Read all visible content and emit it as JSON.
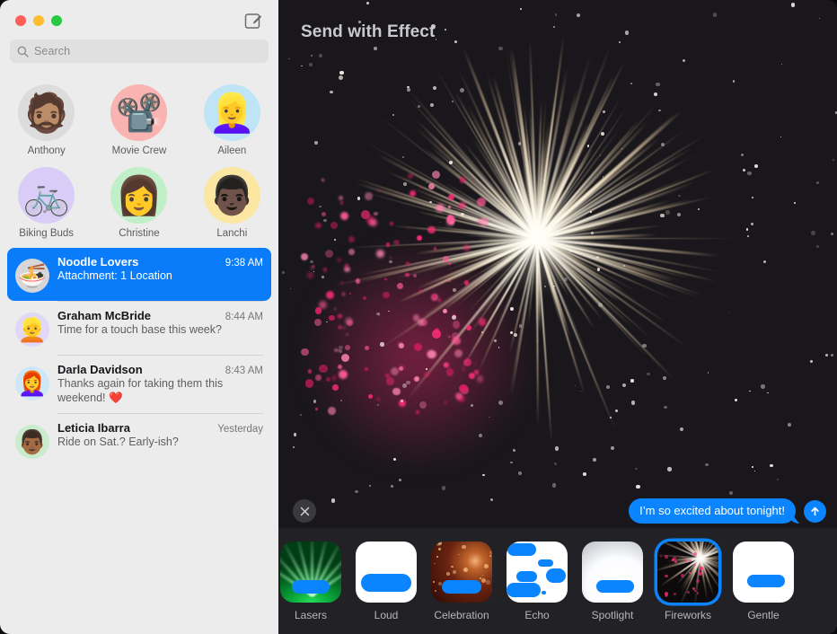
{
  "window": {
    "traffic_lights": [
      "close",
      "minimize",
      "maximize"
    ],
    "colors": {
      "close": "#ff5f57",
      "minimize": "#febc2e",
      "maximize": "#28c840",
      "accent_blue": "#0a7cfa",
      "bubble_blue": "#0a84ff",
      "sidebar_bg": "#ececec",
      "stage_bg": "#19171b",
      "strip_bg": "#222226"
    }
  },
  "sidebar": {
    "compose_icon": "compose-pencil-icon",
    "search": {
      "icon": "search-icon",
      "placeholder": "Search",
      "value": ""
    },
    "pinned": [
      {
        "label": "Anthony",
        "glyph": "🧔🏽",
        "bg": "#dcdcdc"
      },
      {
        "label": "Movie Crew",
        "glyph": "📽️",
        "bg": "#f9b3b0"
      },
      {
        "label": "Aileen",
        "glyph": "👱‍♀️",
        "bg": "#bfe4f5"
      },
      {
        "label": "Biking Buds",
        "glyph": "🚲",
        "bg": "#d9cdf7"
      },
      {
        "label": "Christine",
        "glyph": "👩",
        "bg": "#c1efc7"
      },
      {
        "label": "Lanchi",
        "glyph": "👨🏿",
        "bg": "#fbe6a2"
      }
    ],
    "conversations": [
      {
        "name": "Noodle Lovers",
        "time": "9:38 AM",
        "preview": "Attachment: 1 Location",
        "glyph": "🍜",
        "bg": "#d6d6d8",
        "selected": true
      },
      {
        "name": "Graham McBride",
        "time": "8:44 AM",
        "preview": "Time for a touch base this week?",
        "glyph": "👱",
        "bg": "#e1d7f8",
        "selected": false
      },
      {
        "name": "Darla Davidson",
        "time": "8:43 AM",
        "preview": "Thanks again for taking them this weekend! ❤️",
        "glyph": "👩‍🦰",
        "bg": "#cfe8f7",
        "selected": false
      },
      {
        "name": "Leticia Ibarra",
        "time": "Yesterday",
        "preview": "Ride on Sat.? Early-ish?",
        "glyph": "👨🏾",
        "bg": "#c9edcc",
        "selected": false
      }
    ]
  },
  "main": {
    "title": "Send with Effect",
    "close_effect_icon": "close-icon",
    "message": {
      "text": "I’m so excited about tonight!",
      "send_icon": "send-arrow-up-icon"
    },
    "preview_effect": "Fireworks",
    "effects": [
      {
        "label": "",
        "art": "clipped",
        "selected": false
      },
      {
        "label": "Lasers",
        "art": "lasers",
        "selected": false
      },
      {
        "label": "Loud",
        "art": "loud",
        "selected": false
      },
      {
        "label": "Celebration",
        "art": "celebration",
        "selected": false
      },
      {
        "label": "Echo",
        "art": "echo",
        "selected": false
      },
      {
        "label": "Spotlight",
        "art": "spotlight",
        "selected": false
      },
      {
        "label": "Fireworks",
        "art": "fireworks",
        "selected": true
      },
      {
        "label": "Gentle",
        "art": "gentle",
        "selected": false
      }
    ]
  }
}
